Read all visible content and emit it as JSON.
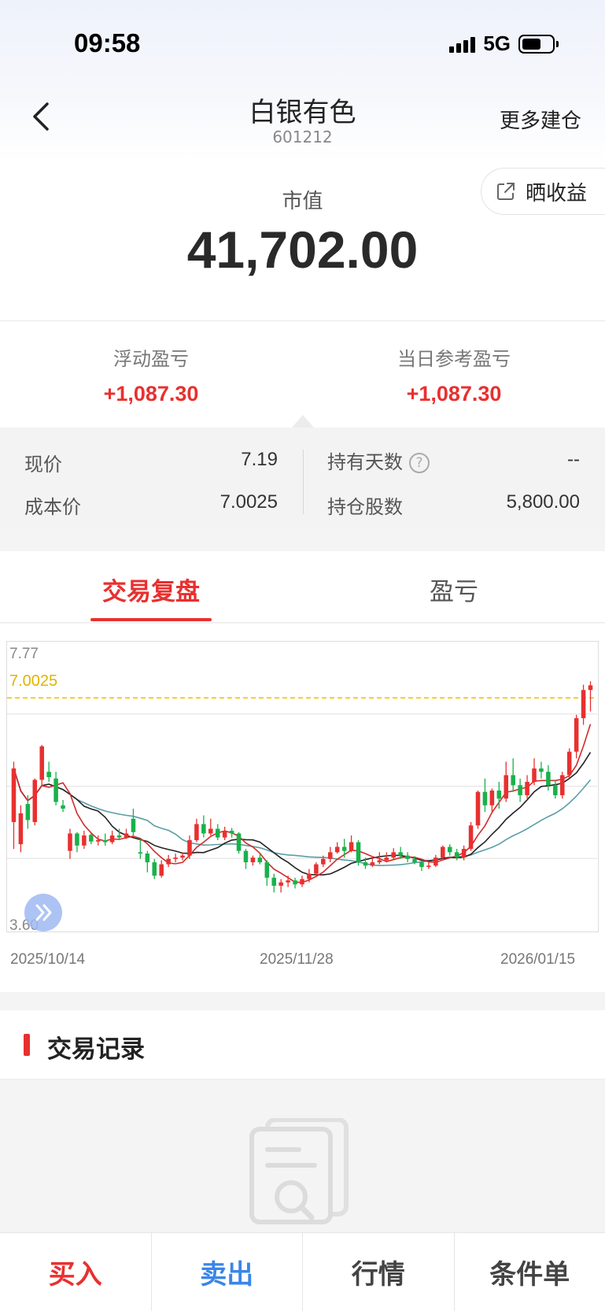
{
  "status_bar": {
    "time": "09:58",
    "network": "5G"
  },
  "header": {
    "title": "白银有色",
    "code": "601212",
    "more_label": "更多建仓"
  },
  "market_value": {
    "label": "市值",
    "value": "41,702.00",
    "share_label": "晒收益"
  },
  "pnl": {
    "floating": {
      "label": "浮动盈亏",
      "value": "+1,087.30"
    },
    "daily": {
      "label": "当日参考盈亏",
      "value": "+1,087.30"
    }
  },
  "details": {
    "current_price": {
      "label": "现价",
      "value": "7.19"
    },
    "cost_price": {
      "label": "成本价",
      "value": "7.0025"
    },
    "holding_days": {
      "label": "持有天数",
      "value": "--",
      "help": "?"
    },
    "shares": {
      "label": "持仓股数",
      "value": "5,800.00"
    }
  },
  "tabs": [
    {
      "label": "交易复盘",
      "active": true
    },
    {
      "label": "盈亏",
      "active": false
    }
  ],
  "records": {
    "title": "交易记录"
  },
  "bottom_bar": {
    "buy": "买入",
    "sell": "卖出",
    "quote": "行情",
    "conditional": "条件单"
  },
  "colors": {
    "up": "#e8302f",
    "down": "#19b14b",
    "cost_line": "#f2c200",
    "ma5": "#d42a2a",
    "ma10": "#222222",
    "ma20": "#5a9ea6",
    "sell_blue": "#3a86e8"
  },
  "chart_data": {
    "type": "candlestick",
    "ylim": [
      3.6,
      7.77
    ],
    "y_ticks": [
      "7.77",
      "3.60"
    ],
    "reference_line": {
      "label": "7.0025",
      "value": 7.0025
    },
    "x_ticks": [
      "2025/10/14",
      "2025/11/28",
      "2026/01/15"
    ],
    "candles": [
      [
        5.15,
        5.95,
        6.05,
        4.75
      ],
      [
        4.82,
        5.28,
        5.4,
        4.7
      ],
      [
        5.42,
        5.18,
        5.55,
        5.05
      ],
      [
        5.15,
        5.78,
        5.8,
        5.1
      ],
      [
        5.78,
        6.28,
        6.3,
        5.7
      ],
      [
        5.9,
        5.82,
        6.05,
        5.75
      ],
      [
        5.8,
        5.45,
        5.9,
        5.4
      ],
      [
        5.4,
        5.35,
        5.48,
        5.3
      ],
      [
        4.72,
        4.98,
        5.05,
        4.6
      ],
      [
        4.98,
        4.8,
        5.0,
        4.7
      ],
      [
        4.8,
        4.95,
        5.02,
        4.75
      ],
      [
        4.96,
        4.86,
        4.98,
        4.82
      ],
      [
        4.86,
        4.88,
        4.95,
        4.8
      ],
      [
        4.88,
        4.85,
        4.98,
        4.8
      ],
      [
        4.85,
        4.95,
        5.02,
        4.82
      ],
      [
        4.95,
        4.92,
        5.05,
        4.88
      ],
      [
        4.92,
        4.98,
        5.05,
        4.9
      ],
      [
        5.2,
        5.0,
        5.35,
        4.95
      ],
      [
        4.7,
        4.68,
        4.9,
        4.6
      ],
      [
        4.68,
        4.55,
        4.72,
        4.4
      ],
      [
        4.55,
        4.35,
        4.6,
        4.3
      ],
      [
        4.35,
        4.52,
        4.58,
        4.32
      ],
      [
        4.52,
        4.6,
        4.66,
        4.48
      ],
      [
        4.6,
        4.62,
        4.68,
        4.55
      ],
      [
        4.62,
        4.65,
        4.7,
        4.58
      ],
      [
        4.65,
        4.88,
        4.95,
        4.6
      ],
      [
        4.88,
        5.12,
        5.2,
        4.85
      ],
      [
        5.12,
        4.98,
        5.25,
        4.92
      ],
      [
        4.98,
        5.05,
        5.2,
        4.95
      ],
      [
        5.05,
        4.92,
        5.12,
        4.88
      ],
      [
        4.92,
        5.02,
        5.08,
        4.88
      ],
      [
        5.02,
        4.98,
        5.06,
        4.92
      ],
      [
        4.98,
        4.72,
        5.0,
        4.68
      ],
      [
        4.72,
        4.55,
        4.75,
        4.45
      ],
      [
        4.55,
        4.62,
        4.65,
        4.5
      ],
      [
        4.62,
        4.55,
        4.68,
        4.52
      ],
      [
        4.55,
        4.32,
        4.58,
        4.2
      ],
      [
        4.32,
        4.2,
        4.38,
        4.1
      ],
      [
        4.2,
        4.25,
        4.3,
        4.1
      ],
      [
        4.25,
        4.28,
        4.35,
        4.18
      ],
      [
        4.28,
        4.22,
        4.32,
        4.16
      ],
      [
        4.22,
        4.3,
        4.35,
        4.18
      ],
      [
        4.3,
        4.38,
        4.45,
        4.25
      ],
      [
        4.38,
        4.52,
        4.55,
        4.35
      ],
      [
        4.52,
        4.6,
        4.65,
        4.48
      ],
      [
        4.6,
        4.7,
        4.78,
        4.55
      ],
      [
        4.7,
        4.78,
        4.85,
        4.68
      ],
      [
        4.78,
        4.72,
        4.9,
        4.62
      ],
      [
        4.72,
        4.85,
        4.95,
        4.7
      ],
      [
        4.85,
        4.55,
        4.88,
        4.5
      ],
      [
        4.55,
        4.5,
        4.62,
        4.45
      ],
      [
        4.5,
        4.55,
        4.62,
        4.48
      ],
      [
        4.55,
        4.58,
        4.7,
        4.52
      ],
      [
        4.58,
        4.62,
        4.7,
        4.55
      ],
      [
        4.62,
        4.7,
        4.76,
        4.58
      ],
      [
        4.7,
        4.65,
        4.78,
        4.6
      ],
      [
        4.65,
        4.6,
        4.7,
        4.55
      ],
      [
        4.6,
        4.55,
        4.64,
        4.52
      ],
      [
        4.55,
        4.48,
        4.58,
        4.42
      ],
      [
        4.48,
        4.5,
        4.56,
        4.45
      ],
      [
        4.5,
        4.62,
        4.66,
        4.48
      ],
      [
        4.62,
        4.78,
        4.8,
        4.6
      ],
      [
        4.78,
        4.7,
        4.82,
        4.65
      ],
      [
        4.7,
        4.62,
        4.75,
        4.58
      ],
      [
        4.62,
        4.75,
        4.8,
        4.58
      ],
      [
        4.75,
        5.1,
        5.15,
        4.72
      ],
      [
        5.1,
        5.6,
        5.62,
        5.05
      ],
      [
        5.6,
        5.4,
        5.8,
        5.3
      ],
      [
        5.4,
        5.62,
        5.65,
        5.3
      ],
      [
        5.62,
        5.5,
        5.75,
        5.35
      ],
      [
        5.5,
        5.85,
        6.05,
        5.45
      ],
      [
        5.85,
        5.7,
        6.1,
        5.6
      ],
      [
        5.7,
        5.55,
        5.8,
        5.45
      ],
      [
        5.55,
        5.75,
        5.85,
        5.5
      ],
      [
        5.75,
        5.95,
        6.1,
        5.7
      ],
      [
        5.95,
        5.9,
        6.05,
        5.8
      ],
      [
        5.9,
        5.7,
        6.0,
        5.62
      ],
      [
        5.7,
        5.55,
        5.78,
        5.5
      ],
      [
        5.55,
        5.85,
        5.9,
        5.5
      ],
      [
        5.85,
        6.2,
        6.25,
        5.8
      ],
      [
        6.2,
        6.7,
        6.75,
        6.1
      ],
      [
        6.7,
        7.12,
        7.2,
        6.6
      ],
      [
        7.12,
        7.19,
        7.25,
        6.8
      ]
    ]
  }
}
